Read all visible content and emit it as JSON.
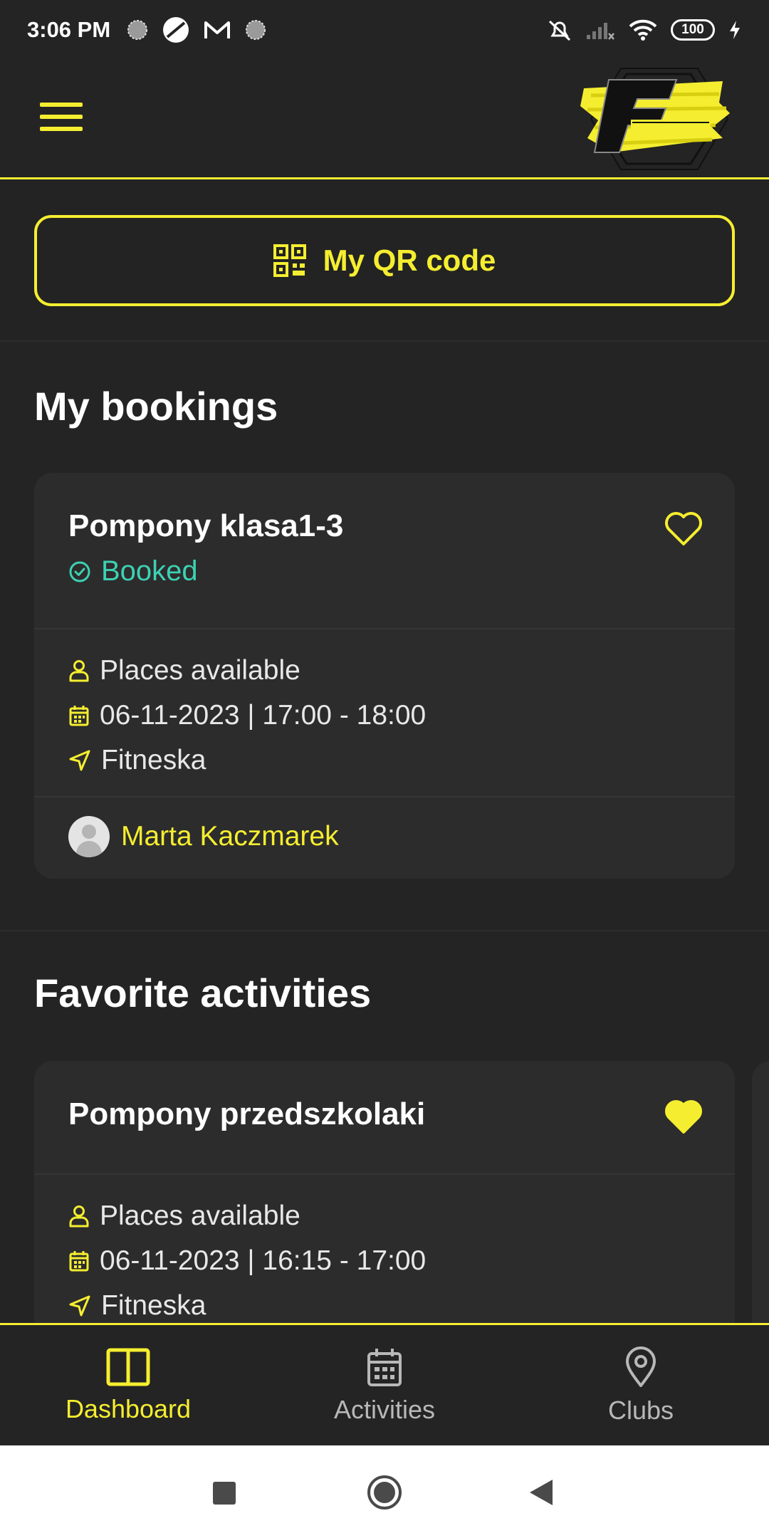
{
  "status_bar": {
    "time": "3:06 PM",
    "battery": "100"
  },
  "qr": {
    "label": "My QR code"
  },
  "bookings": {
    "title": "My bookings",
    "items": [
      {
        "title": "Pompony klasa1-3",
        "status": "Booked",
        "places": "Places available",
        "datetime": "06-11-2023 | 17:00 - 18:00",
        "location": "Fitneska",
        "instructor": "Marta Kaczmarek"
      }
    ]
  },
  "favorites": {
    "title": "Favorite activities",
    "items": [
      {
        "title": "Pompony przedszkolaki",
        "places": "Places available",
        "datetime": "06-11-2023 | 16:15 - 17:00",
        "location": "Fitneska"
      }
    ]
  },
  "nav": {
    "items": [
      {
        "label": "Dashboard",
        "icon": "dashboard-icon",
        "active": true
      },
      {
        "label": "Activities",
        "icon": "calendar-icon",
        "active": false
      },
      {
        "label": "Clubs",
        "icon": "location-pin-icon",
        "active": false
      }
    ]
  },
  "colors": {
    "accent": "#f5ee30",
    "booked": "#3dd1b3",
    "background": "#242424",
    "card": "#2c2c2c"
  }
}
